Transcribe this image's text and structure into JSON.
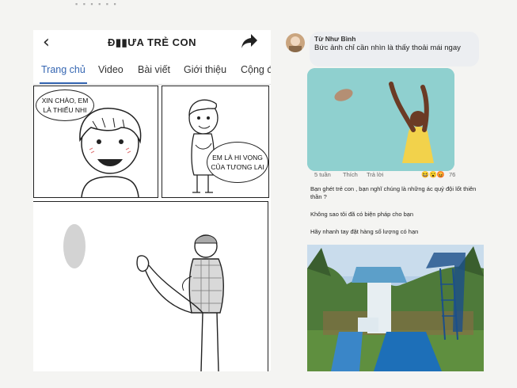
{
  "header": {
    "back_icon": "back-arrow-icon",
    "title": "Đ▮▮ƯA TRẺ CON",
    "share_icon": "share-icon"
  },
  "tabs": [
    {
      "label": "Trang chủ",
      "active": true
    },
    {
      "label": "Video",
      "active": false
    },
    {
      "label": "Bài viết",
      "active": false
    },
    {
      "label": "Giới thiệu",
      "active": false
    },
    {
      "label": "Cộng đ",
      "active": false
    }
  ],
  "comic": {
    "bubble1": "XIN CHÀO, EM LÀ THIẾU NHI",
    "bubble2": "EM LÀ HI VỌNG CỦA TƯƠNG LAI"
  },
  "comment": {
    "author": "Từ Như Bình",
    "text": "Bức ảnh chỉ cần nhìn là thấy thoải mái ngay",
    "time": "5 tuần",
    "like_label": "Thích",
    "reply_label": "Trả lời",
    "reaction_count": "76"
  },
  "messages": [
    "Bạn ghét trẻ con , bạn nghĩ chúng là những ác quỷ đội lốt thiên thần ?",
    "Không sao tôi đã có biện pháp cho bạn",
    "Hãy nhanh tay đặt hàng số lượng có hạn"
  ],
  "colors": {
    "accent": "#3566b2",
    "comment_bg": "#eceef1"
  }
}
